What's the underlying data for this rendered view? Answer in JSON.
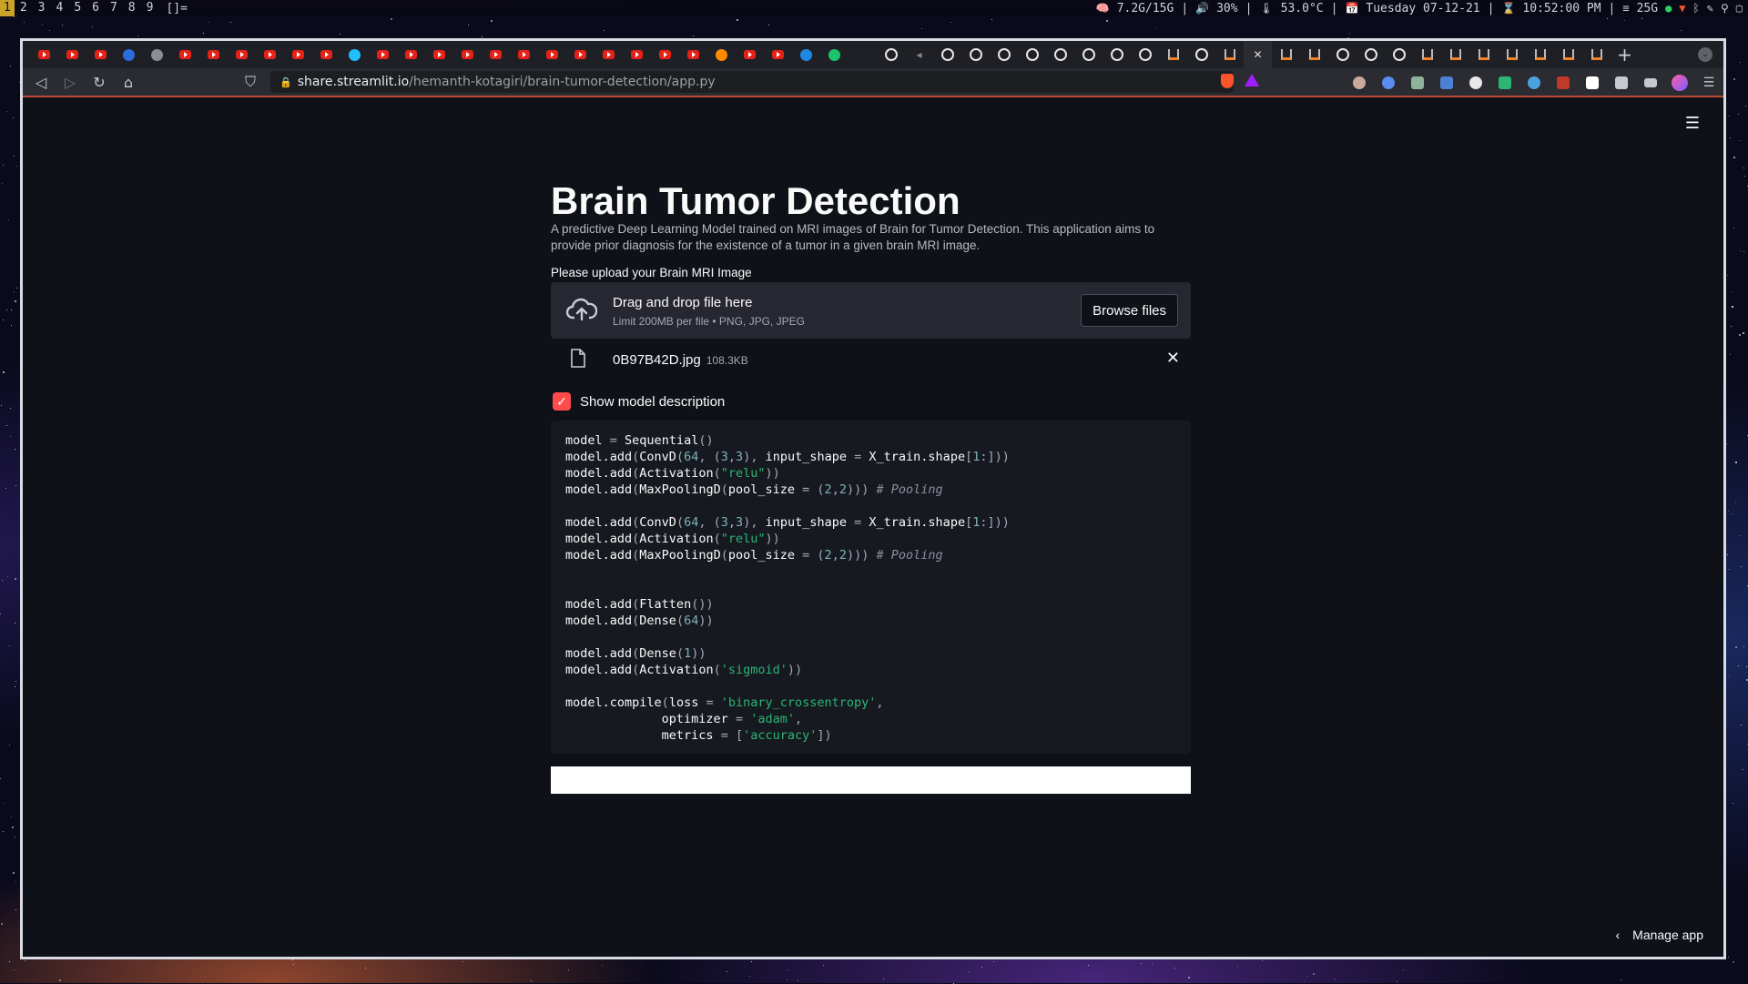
{
  "statusbar": {
    "workspaces": [
      "1",
      "2",
      "3",
      "4",
      "5",
      "6",
      "7",
      "8",
      "9"
    ],
    "active_workspace": "1",
    "layout": "[]=",
    "memory": "7.2G/15G",
    "volume": "30%",
    "temperature": "53.0°C",
    "date": "Tuesday 07-12-21",
    "time": "10:52:00 PM",
    "storage": "25G"
  },
  "browser": {
    "url_host": "share.streamlit.io",
    "url_path": "/hemanth-kotagiri/brain-tumor-detection/app.py",
    "brave_badge": "3",
    "tab_icons": [
      "youtube",
      "youtube",
      "youtube",
      "c",
      "globe",
      "youtube",
      "youtube",
      "youtube",
      "youtube",
      "youtube",
      "youtube",
      "kaggle",
      "youtube",
      "youtube",
      "youtube",
      "youtube",
      "youtube",
      "youtube",
      "youtube",
      "youtube",
      "youtube",
      "youtube",
      "youtube",
      "youtube",
      "firefox",
      "youtube",
      "youtube",
      "k",
      "replit",
      "blank",
      "github",
      "mute",
      "github",
      "github",
      "github",
      "github",
      "github",
      "github",
      "github",
      "github",
      "stackoverflow",
      "github",
      "stackoverflow",
      "active-close",
      "stackoverflow",
      "stackoverflow",
      "github",
      "github",
      "github",
      "stackoverflow",
      "stackoverflow",
      "stackoverflow",
      "stackoverflow",
      "stackoverflow",
      "stackoverflow",
      "stackoverflow"
    ]
  },
  "app": {
    "title": "Brain Tumor Detection",
    "description": "A predictive Deep Learning Model trained on MRI images of Brain for Tumor Detection. This application aims to provide prior diagnosis for the existence of a tumor in a given brain MRI image.",
    "upload_label": "Please upload your Brain MRI Image",
    "dropzone_title": "Drag and drop file here",
    "dropzone_limit": "Limit 200MB per file • PNG, JPG, JPEG",
    "browse_label": "Browse files",
    "file_name": "0B97B42D.jpg",
    "file_size": "108.3KB",
    "checkbox_label": "Show model description",
    "checkbox_checked": true,
    "manage_app": "Manage app",
    "code_lines": [
      "model = Sequential()",
      "model.add(Conv2D(64, (3,3), input_shape = X_train.shape[1:]))",
      "model.add(Activation(\"relu\"))",
      "model.add(MaxPooling2D(pool_size = (2,2))) # Pooling",
      "",
      "model.add(Conv2D(64, (3,3), input_shape = X_train.shape[1:]))",
      "model.add(Activation(\"relu\"))",
      "model.add(MaxPooling2D(pool_size = (2,2))) # Pooling",
      "",
      "",
      "model.add(Flatten())",
      "model.add(Dense(64))",
      "",
      "model.add(Dense(1))",
      "model.add(Activation('sigmoid'))",
      "",
      "model.compile(loss = 'binary_crossentropy',",
      "             optimizer = 'adam',",
      "             metrics = ['accuracy'])"
    ]
  },
  "colors": {
    "streamlit_bg": "#0e1117",
    "accent": "#ff4b4b",
    "code_string": "#2bb673",
    "code_number": "#7fb2b9"
  }
}
